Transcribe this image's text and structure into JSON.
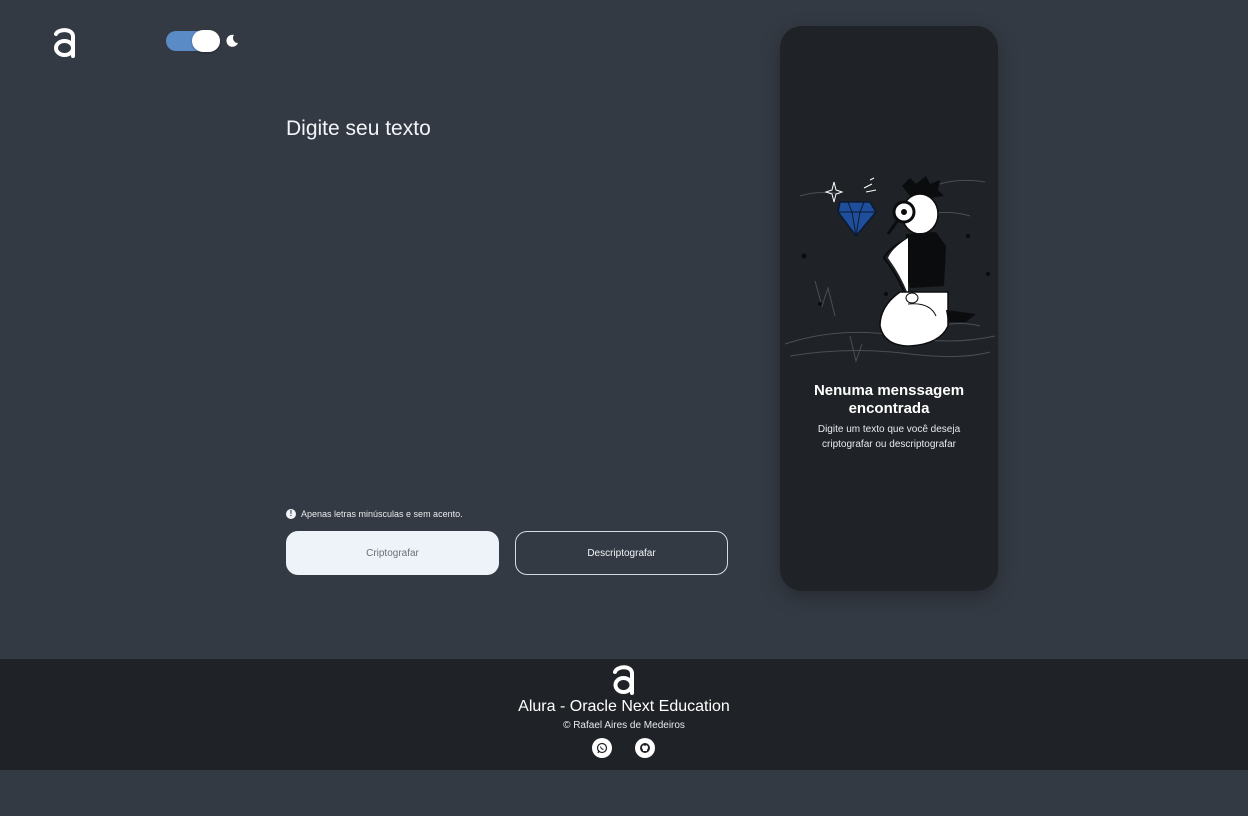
{
  "header": {
    "logo_icon": "alura-logo-icon",
    "theme_toggle": {
      "state": "dark",
      "icon": "moon-icon"
    }
  },
  "input": {
    "placeholder": "Digite seu texto"
  },
  "hint": {
    "icon": "exclamation-circle-icon",
    "text": "Apenas letras minúsculas e sem acento."
  },
  "buttons": {
    "encrypt_label": "Criptografar",
    "decrypt_label": "Descriptografar"
  },
  "output": {
    "illustration": "person-with-magnifying-glass-and-diamond",
    "title": "Nenuma menssagem encontrada",
    "text": "Digite um texto que você deseja criptografar ou descriptografar"
  },
  "footer": {
    "logo_icon": "alura-logo-icon",
    "title": "Alura - Oracle Next Education",
    "copyright": "© Rafael Aires de Medeiros",
    "social": [
      "whatsapp-icon",
      "github-icon"
    ]
  },
  "colors": {
    "background": "#343A43",
    "panel": "#1F2226",
    "accent": "#5B8BC7",
    "light_button": "#EEF2F9",
    "diamond": "#1F4E9A"
  }
}
